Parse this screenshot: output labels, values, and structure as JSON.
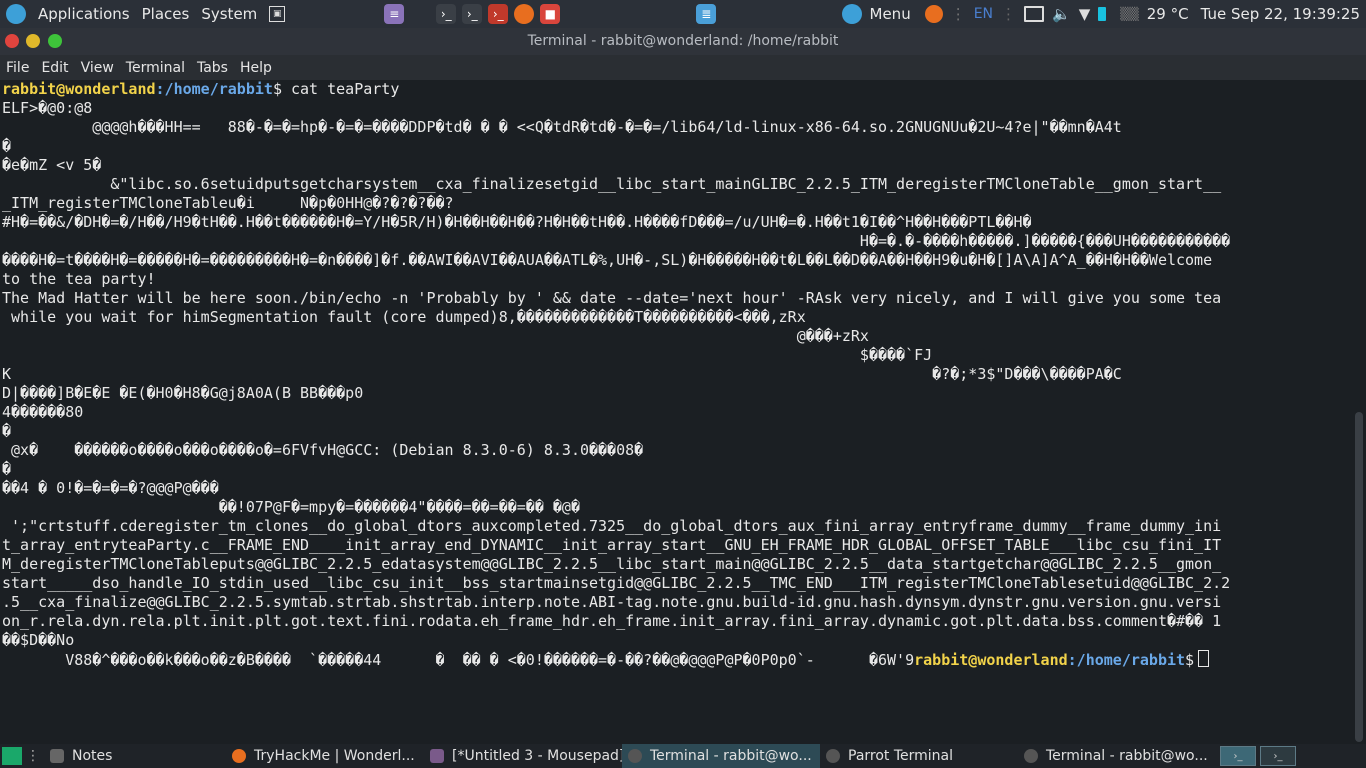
{
  "topbar": {
    "applications": "Applications",
    "places": "Places",
    "system": "System",
    "menu": "Menu",
    "keyboard_layout": "EN",
    "temperature": "29 °C",
    "datetime": "Tue Sep 22, 19:39:25"
  },
  "window": {
    "title": "Terminal - rabbit@wonderland: /home/rabbit"
  },
  "menubar": {
    "items": [
      "File",
      "Edit",
      "View",
      "Terminal",
      "Tabs",
      "Help"
    ]
  },
  "terminal": {
    "prompt_user_host": "rabbit@wonderland",
    "prompt_path": ":/home/rabbit",
    "prompt_symbol": "$",
    "command": " cat teaParty",
    "lines": [
      "ELF>�@0:@8",
      "          @@@@h���HH==   88�-�=�=hp�-�=�=����DDP�td� � � <<Q�tdR�td�-�=�=/lib64/ld-linux-x86-64.so.2GNUGNUu�2U~4?e|\"��mn�A4t",
      "�",
      "�e�mZ <v 5�",
      "            &\"libc.so.6setuidputsgetcharsystem__cxa_finalizesetgid__libc_start_mainGLIBC_2.2.5_ITM_deregisterTMCloneTable__gmon_start__",
      "_ITM_registerTMCloneTableu�i     N�p�0HH@�?�?�?��?",
      "#H�=��&/�DH�=�/H��/H9�tH��.H��t������H�=Y/H�5R/H)�H��H��H��?H�H��tH��.H����fD���=/u/UH�=�.H��t1�I��^H��H���PTL��H�",
      "                                                                                               H�=�.�-����h�����.]�����{���UH�����������",
      "����H�=t����H�=�����H�=���������H�=�n����]�f.��AWI��AVI��AUA��ATL�%,UH�-,SL)�H�����H��t�L��L��D��A��H��H9�u�H�[]A\\A]A^A_��H�H��Welcome",
      "to the tea party!",
      "The Mad Hatter will be here soon./bin/echo -n 'Probably by ' && date --date='next hour' -RAsk very nicely, and I will give you some tea",
      " while you wait for himSegmentation fault (core dumped)8,�������������T����������<���,zRx",
      "                                                                                        @���+zRx",
      "                                                                                               $����`FJ",
      "K                                                                                                      �?�;*3$\"D���\\����PA�C",
      "D|����]B�E�E �E(�H0�H8�G@j8A0A(B BB���p0",
      "4������80",
      "�",
      " @x�    ������o����o���o����o�=6FVfvH@GCC: (Debian 8.3.0-6) 8.3.0���08�",
      "�",
      "",
      "��4 � 0!�=�=�=�?@@@P@���",
      "                        ��!07P@F�=mpy�=������4\"����=��=��=�� �@�",
      " ';\"crtstuff.cderegister_tm_clones__do_global_dtors_auxcompleted.7325__do_global_dtors_aux_fini_array_entryframe_dummy__frame_dummy_ini",
      "t_array_entryteaParty.c__FRAME_END____init_array_end_DYNAMIC__init_array_start__GNU_EH_FRAME_HDR_GLOBAL_OFFSET_TABLE___libc_csu_fini_IT",
      "M_deregisterTMCloneTableputs@@GLIBC_2.2.5_edatasystem@@GLIBC_2.2.5__libc_start_main@@GLIBC_2.2.5__data_startgetchar@@GLIBC_2.2.5__gmon_",
      "start_____dso_handle_IO_stdin_used__libc_csu_init__bss_startmainsetgid@@GLIBC_2.2.5__TMC_END___ITM_registerTMCloneTablesetuid@@GLIBC_2.2",
      ".5__cxa_finalize@@GLIBC_2.2.5.symtab.strtab.shstrtab.interp.note.ABI-tag.note.gnu.build-id.gnu.hash.dynsym.dynstr.gnu.version.gnu.versi",
      "on_r.rela.dyn.rela.plt.init.plt.got.text.fini.rodata.eh_frame_hdr.eh_frame.init_array.fini_array.dynamic.got.plt.data.bss.comment�#�� 1",
      "��$D��No"
    ],
    "last_line_text": "       V88�^���o��k���o��z�B����  `�����44      �  �� � <�0!������=�-��?��@�@@@P@P�0P0p0`-      �6W'9",
    "cursor": ""
  },
  "taskbar": {
    "notes": "Notes",
    "tasks": [
      "TryHackMe | Wonderl...",
      "[*Untitled 3 - Mousepad]",
      "Terminal - rabbit@wo...",
      "Parrot Terminal",
      "Terminal - rabbit@wo..."
    ]
  },
  "colors": {
    "prompt_user": "#f2d34a",
    "prompt_path": "#6aa8e8",
    "terminal_bg": "#1b1f23",
    "panel_bg": "#2b3038"
  },
  "icons": {
    "topbar_left": [
      "parrot-logo-icon",
      "notes-icon",
      "terminal-icon",
      "root-terminal-icon",
      "firefox-icon",
      "recorder-icon"
    ],
    "topbar_right": [
      "parrot-menu-icon",
      "firefox-icon",
      "keyboard-icon",
      "display-icon",
      "volume-icon",
      "wifi-icon",
      "battery-icon",
      "weather-icon"
    ]
  }
}
